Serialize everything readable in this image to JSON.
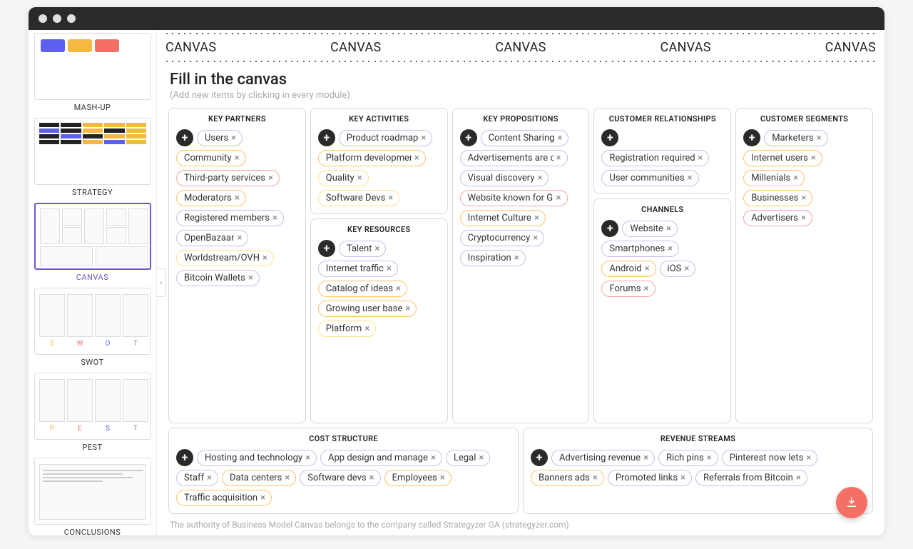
{
  "navTabs": [
    "CANVAS",
    "CANVAS",
    "CANVAS",
    "CANVAS",
    "CANVAS"
  ],
  "heading": {
    "title": "Fill in the canvas",
    "sub": "(Add new items by clicking in every module)"
  },
  "sidebar": [
    {
      "label": "MASH-UP",
      "active": false,
      "style": "mashup"
    },
    {
      "label": "STRATEGY",
      "active": false,
      "style": "strategy"
    },
    {
      "label": "CANVAS",
      "active": true,
      "style": "canvas"
    },
    {
      "label": "SWOT",
      "active": false,
      "style": "swot"
    },
    {
      "label": "PEST",
      "active": false,
      "style": "pest"
    },
    {
      "label": "CONCLUSIONS",
      "active": false,
      "style": "conclusions"
    }
  ],
  "modules": {
    "keyPartners": {
      "title": "KEY PARTNERS",
      "items": [
        {
          "t": "Users",
          "c": 0
        },
        {
          "t": "Community",
          "c": 1
        },
        {
          "t": "Third-party services",
          "c": 2
        },
        {
          "t": "Moderators",
          "c": 1
        },
        {
          "t": "Registered members",
          "c": 0
        },
        {
          "t": "OpenBazaar",
          "c": 0
        },
        {
          "t": "Worldstream/OVH",
          "c": 3
        },
        {
          "t": "Bitcoin Wallets",
          "c": 0
        }
      ]
    },
    "keyActivities": {
      "title": "KEY ACTIVITIES",
      "items": [
        {
          "t": "Product roadmap",
          "c": 0
        },
        {
          "t": "Platform development",
          "c": 1
        },
        {
          "t": "Quality",
          "c": 3
        },
        {
          "t": "Software Devs",
          "c": 3
        }
      ]
    },
    "keyResources": {
      "title": "KEY RESOURCES",
      "items": [
        {
          "t": "Talent",
          "c": 0
        },
        {
          "t": "Internet traffic",
          "c": 0
        },
        {
          "t": "Catalog of ideas",
          "c": 1
        },
        {
          "t": "Growing user base",
          "c": 1
        },
        {
          "t": "Platform",
          "c": 3
        }
      ]
    },
    "keyPropositions": {
      "title": "KEY PROPOSITIONS",
      "items": [
        {
          "t": "Content Sharing",
          "c": 0
        },
        {
          "t": "Advertisements are clear",
          "c": 0
        },
        {
          "t": "Visual discovery",
          "c": 0
        },
        {
          "t": "Website known for GIFs",
          "c": 2
        },
        {
          "t": "Internet Culture",
          "c": 1
        },
        {
          "t": "Cryptocurrency",
          "c": 0
        },
        {
          "t": "Inspiration",
          "c": 0
        }
      ]
    },
    "customerRel": {
      "title": "CUSTOMER RELATIONSHIPS",
      "items": [
        {
          "t": "Registration required",
          "c": 0
        },
        {
          "t": "User communities",
          "c": 0
        }
      ]
    },
    "channels": {
      "title": "CHANNELS",
      "items": [
        {
          "t": "Website",
          "c": 0
        },
        {
          "t": "Smartphones",
          "c": 0
        },
        {
          "t": "Android",
          "c": 1
        },
        {
          "t": "iOS",
          "c": 0
        },
        {
          "t": "Forums",
          "c": 2
        }
      ]
    },
    "customerSeg": {
      "title": "CUSTOMER SEGMENTS",
      "items": [
        {
          "t": "Marketers",
          "c": 0
        },
        {
          "t": "Internet users",
          "c": 1
        },
        {
          "t": "Millenials",
          "c": 1
        },
        {
          "t": "Businesses",
          "c": 1
        },
        {
          "t": "Advertisers",
          "c": 2
        }
      ]
    },
    "cost": {
      "title": "COST STRUCTURE",
      "items": [
        {
          "t": "Hosting and technology",
          "c": 0
        },
        {
          "t": "App design and management",
          "c": 0
        },
        {
          "t": "Legal",
          "c": 0
        },
        {
          "t": "Staff",
          "c": 0
        },
        {
          "t": "Data centers",
          "c": 1
        },
        {
          "t": "Software devs",
          "c": 0
        },
        {
          "t": "Employees",
          "c": 1
        },
        {
          "t": "Traffic acquisition",
          "c": 1
        }
      ]
    },
    "revenue": {
      "title": "REVENUE STREAMS",
      "items": [
        {
          "t": "Advertising revenue",
          "c": 0
        },
        {
          "t": "Rich pins",
          "c": 0
        },
        {
          "t": "Pinterest now lets",
          "c": 0
        },
        {
          "t": "Banners ads",
          "c": 1
        },
        {
          "t": "Promoted links",
          "c": 0
        },
        {
          "t": "Referrals from Bitcoin",
          "c": 0
        }
      ]
    }
  },
  "footer": "The authority of Business Model Canvas belongs to the company called Strategyzer GA (strategyzer.com)"
}
